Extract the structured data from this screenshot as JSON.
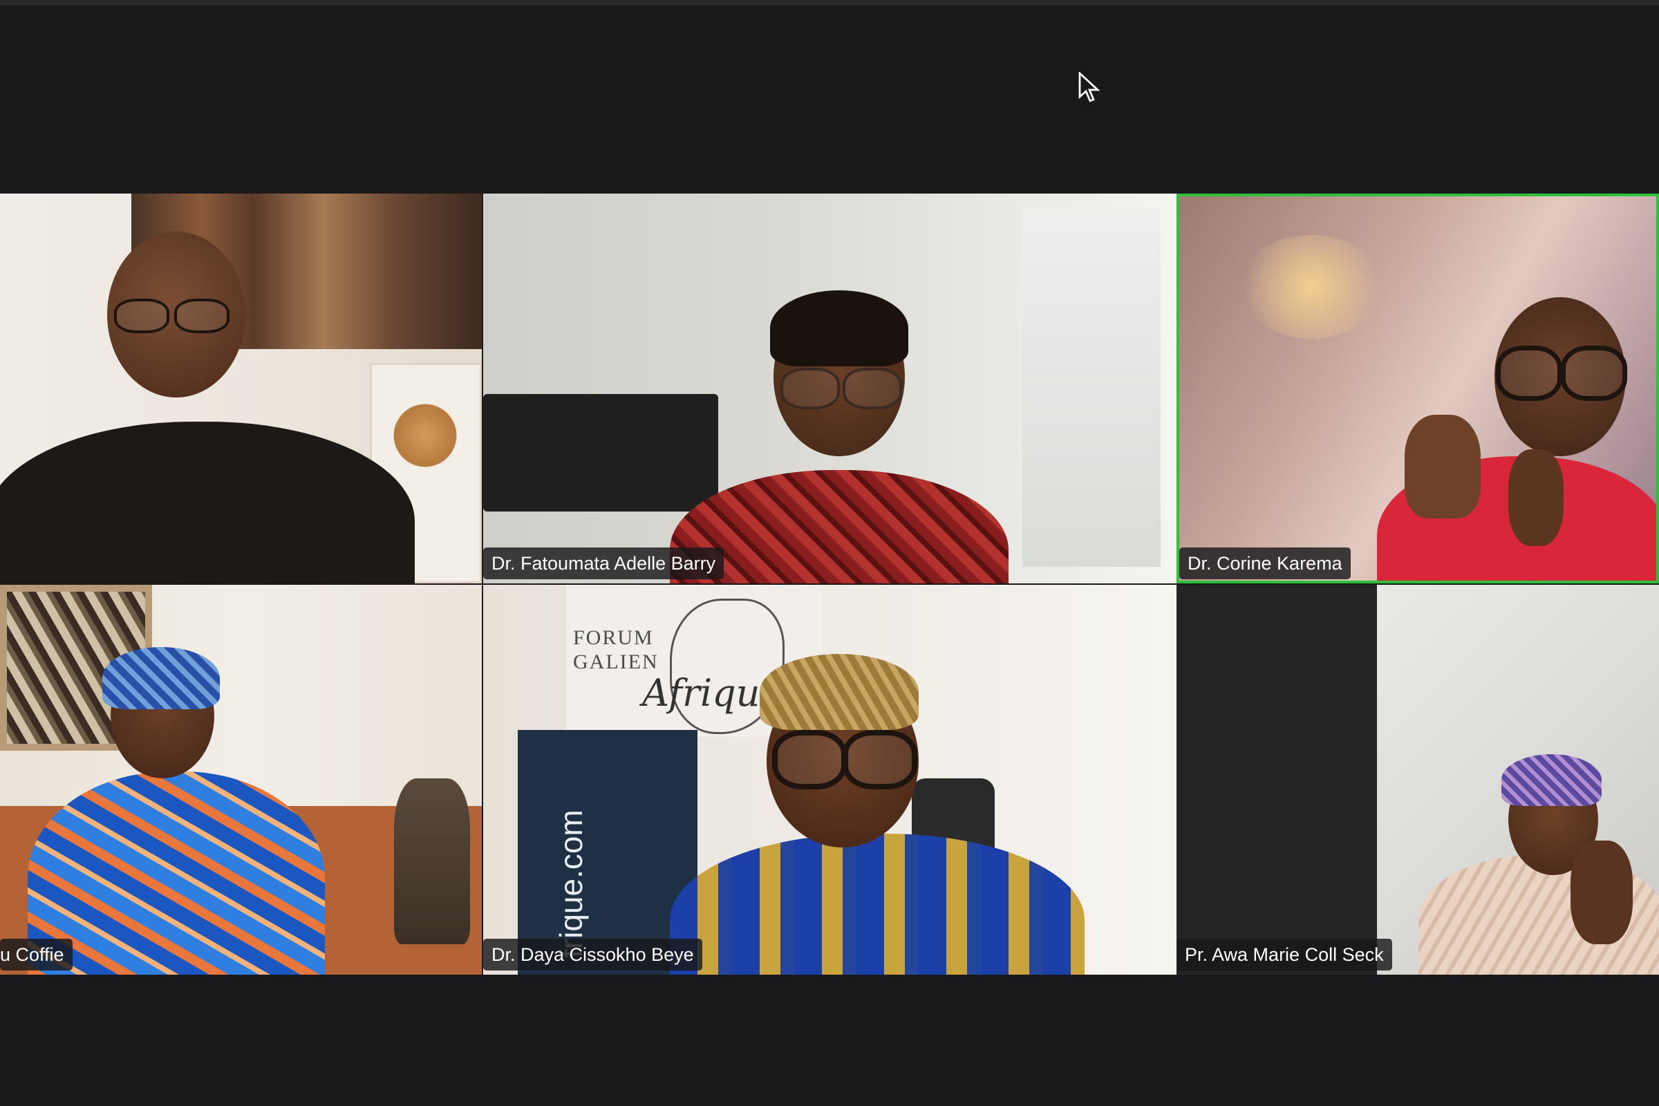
{
  "meeting": {
    "participants": [
      {
        "name": "",
        "active": false
      },
      {
        "name": "Dr. Fatoumata Adelle Barry",
        "active": false
      },
      {
        "name": "Dr. Corine Karema",
        "active": true
      },
      {
        "name": "u Coffie",
        "active": false
      },
      {
        "name": "Dr. Daya Cissokho Beye",
        "active": false
      },
      {
        "name": "Pr. Awa Marie Coll Seck",
        "active": false
      }
    ],
    "banner": {
      "forum_line1": "FORUM",
      "forum_line2": "GALIEN",
      "afrique_script": "Afrique",
      "website_fragment": "frique.com"
    }
  },
  "colors": {
    "background": "#19191b",
    "active_speaker_border": "#2fbf3a",
    "label_background": "#19191b",
    "label_text": "#ffffff"
  },
  "icons": {
    "cursor": "mouse-pointer-icon"
  }
}
